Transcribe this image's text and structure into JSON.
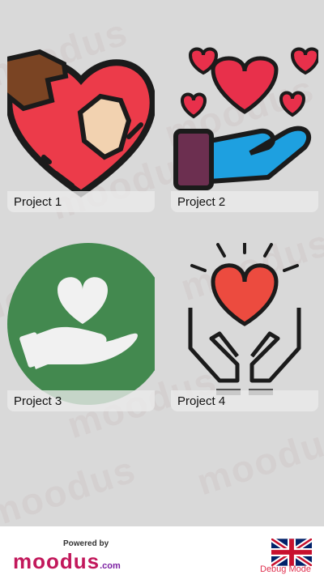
{
  "projects": [
    {
      "label": "Project 1",
      "icon": "heart-hands-icon"
    },
    {
      "label": "Project 2",
      "icon": "hand-giving-hearts-icon"
    },
    {
      "label": "Project 3",
      "icon": "hand-heart-circle-icon"
    },
    {
      "label": "Project 4",
      "icon": "hands-holding-heart-icon"
    }
  ],
  "watermark": "moodus",
  "footer": {
    "powered_by": "Powered by",
    "brand": "moodus",
    "brand_suffix": ".com",
    "language_flag": "uk-flag-icon",
    "debug_label": "Debug Mode"
  },
  "colors": {
    "background": "#d9d9d9",
    "brand_pink": "#c2185b",
    "brand_purple": "#7b1fa2",
    "debug_red": "#e0314f"
  }
}
